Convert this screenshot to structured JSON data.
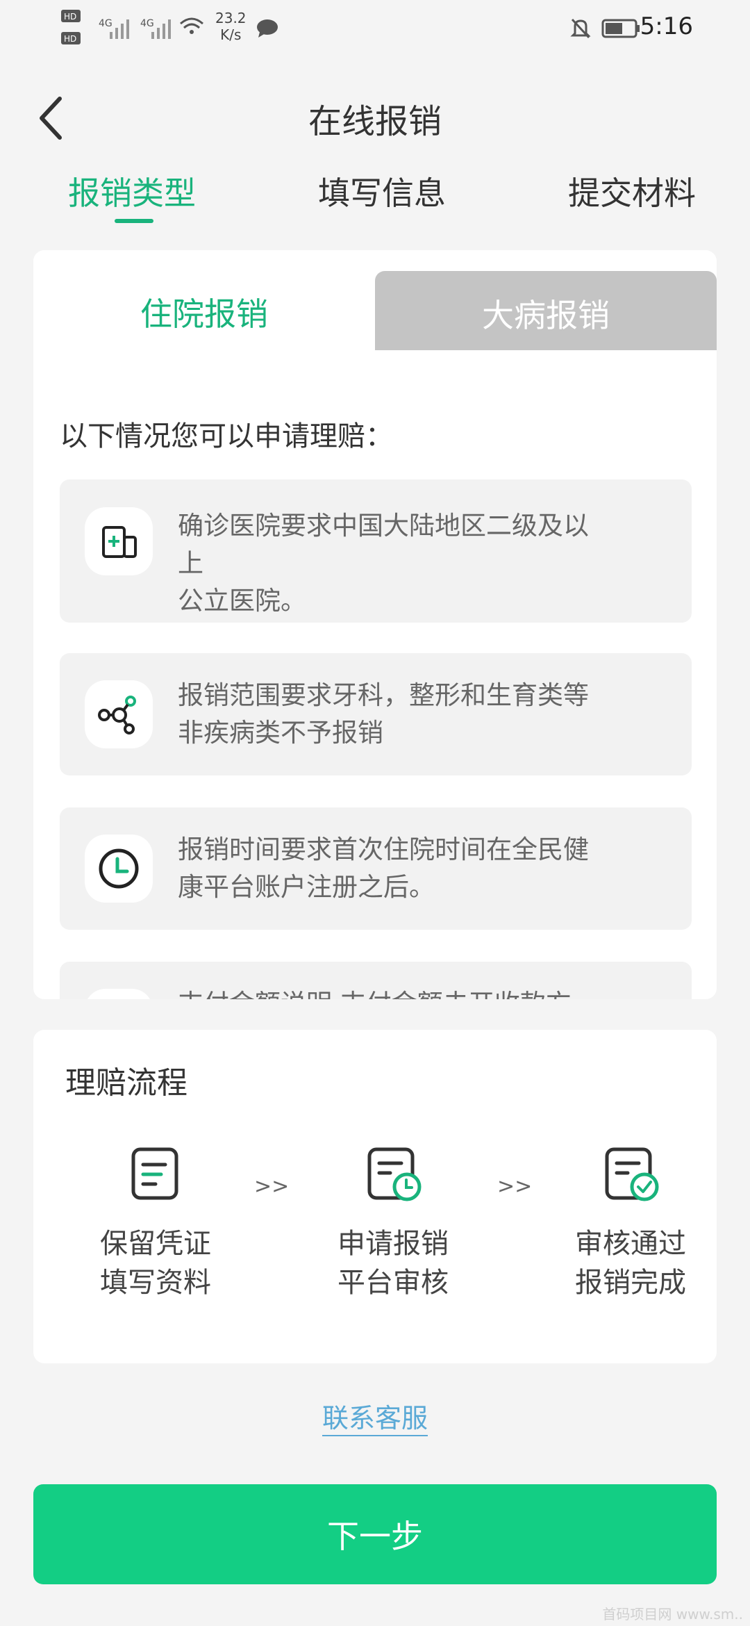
{
  "status_bar": {
    "speed_value": "23.2",
    "speed_unit": "K/s",
    "time": "5:16"
  },
  "header": {
    "title": "在线报销"
  },
  "steps": [
    {
      "label": "报销类型",
      "active": true
    },
    {
      "label": "填写信息",
      "active": false
    },
    {
      "label": "提交材料",
      "active": false
    }
  ],
  "tabs": [
    {
      "label": "住院报销",
      "active": true
    },
    {
      "label": "大病报销",
      "active": false
    }
  ],
  "intro": "以下情况您可以申请理赔：",
  "conditions": [
    {
      "icon": "hospital-icon",
      "line1": "确诊医院要求中国大陆地区二级及以",
      "line2": "上",
      "line3": "公立医院。"
    },
    {
      "icon": "network-icon",
      "line1": "报销范围要求牙科，整形和生育类等",
      "line2": "非疾病类不予报销"
    },
    {
      "icon": "clock-icon",
      "line1": "报销时间要求首次住院时间在全民健",
      "line2": "康平台账户注册之后。"
    },
    {
      "icon": "partial-icon",
      "line1": "支付金额说明 支付金额未开收款方"
    }
  ],
  "process": {
    "title": "理赔流程",
    "arrow": ">>",
    "steps": [
      {
        "icon": "document-icon",
        "line1": "保留凭证",
        "line2": "填写资料"
      },
      {
        "icon": "document-clock-icon",
        "line1": "申请报销",
        "line2": "平台审核"
      },
      {
        "icon": "document-check-icon",
        "line1": "审核通过",
        "line2": "报销完成"
      }
    ]
  },
  "contact": "联系客服",
  "next_button": "下一步",
  "colors": {
    "accent": "#19b37c",
    "button": "#13ce84",
    "link": "#5aa9d6",
    "tab_inactive": "#c4c4c4"
  },
  "watermark": "首码项目网 www.sm.."
}
